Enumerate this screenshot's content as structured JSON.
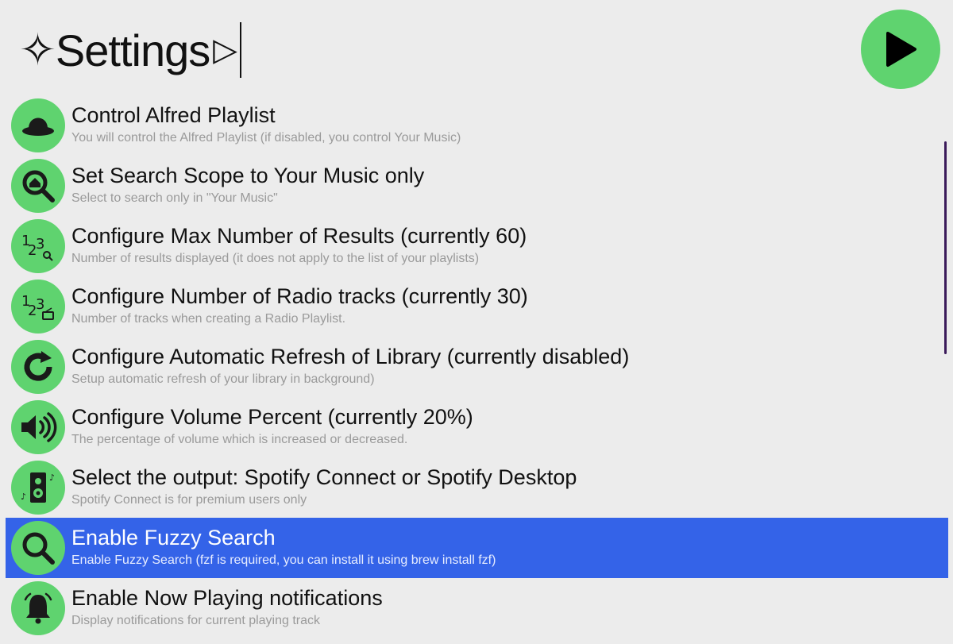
{
  "query": {
    "prefix_glyph": "✧",
    "text": "Settings",
    "suffix_glyph": "▷"
  },
  "play_button": {
    "icon": "play-icon",
    "color": "#5fd36f"
  },
  "colors": {
    "accent": "#5fd36f",
    "selection": "#3463e8",
    "background": "#ececec"
  },
  "results": [
    {
      "icon": "alfred-hat-icon",
      "title": "Control Alfred Playlist",
      "subtitle": "You will control the Alfred Playlist (if disabled, you control Your Music)",
      "selected": false
    },
    {
      "icon": "search-home-icon",
      "title": "Set Search Scope to Your Music only",
      "subtitle": "Select to search only in \"Your Music\"",
      "selected": false
    },
    {
      "icon": "numbers-search-icon",
      "title": "Configure Max Number of Results (currently 60)",
      "subtitle": "Number of results displayed (it does not apply to the list of your playlists)",
      "selected": false
    },
    {
      "icon": "numbers-radio-icon",
      "title": "Configure Number of Radio tracks (currently 30)",
      "subtitle": "Number of tracks when creating a Radio Playlist.",
      "selected": false
    },
    {
      "icon": "refresh-icon",
      "title": "Configure Automatic Refresh of Library (currently disabled)",
      "subtitle": "Setup automatic refresh of your library in background)",
      "selected": false
    },
    {
      "icon": "volume-icon",
      "title": "Configure Volume Percent (currently 20%)",
      "subtitle": "The percentage of volume which is increased or decreased.",
      "selected": false
    },
    {
      "icon": "speaker-icon",
      "title": "Select the output: Spotify Connect or Spotify Desktop",
      "subtitle": "Spotify Connect is for premium users only",
      "selected": false
    },
    {
      "icon": "search-icon",
      "title": "Enable Fuzzy Search",
      "subtitle": "Enable Fuzzy Search (fzf is required, you can install it using brew install fzf)",
      "selected": true
    },
    {
      "icon": "bell-icon",
      "title": "Enable Now Playing notifications",
      "subtitle": "Display notifications for current playing track",
      "selected": false
    }
  ]
}
